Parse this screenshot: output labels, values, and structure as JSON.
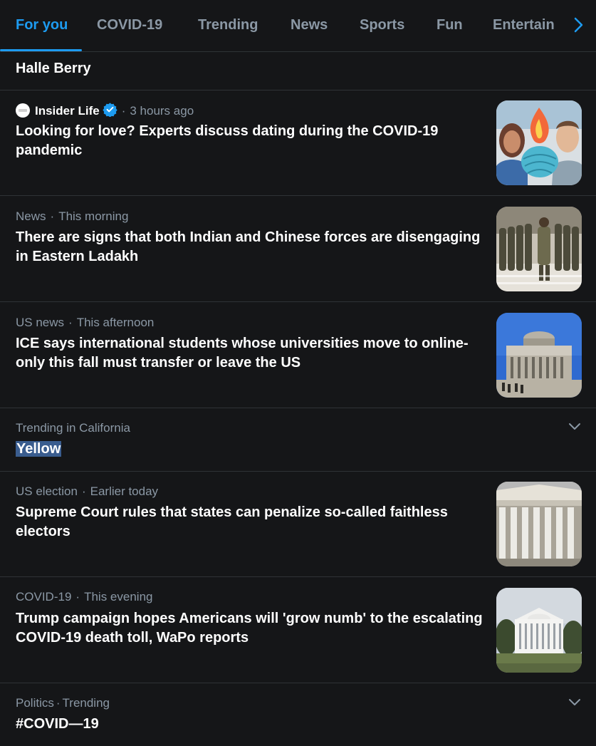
{
  "tabs": [
    {
      "label": "For you",
      "active": true
    },
    {
      "label": "COVID-19",
      "active": false
    },
    {
      "label": "Trending",
      "active": false
    },
    {
      "label": "News",
      "active": false
    },
    {
      "label": "Sports",
      "active": false
    },
    {
      "label": "Fun",
      "active": false
    },
    {
      "label": "Entertain",
      "active": false
    }
  ],
  "top_item": {
    "title": "Halle Berry"
  },
  "items": [
    {
      "source": "Insider Life",
      "verified": true,
      "time": "3 hours ago",
      "title": "Looking for love? Experts discuss dating during the COVID-19 pandemic",
      "thumb_icon": "dating-photo"
    },
    {
      "category": "News",
      "time": "This morning",
      "title": "There are signs that both Indian and Chinese forces are disengaging in Eastern Ladakh",
      "thumb_icon": "soldiers-photo"
    },
    {
      "category": "US news",
      "time": "This afternoon",
      "title": "ICE says international students whose universities move to online-only this fall must transfer or leave the US",
      "thumb_icon": "university-photo"
    },
    {
      "category": "Trending in California",
      "title": "Yellow",
      "trend": true
    },
    {
      "category": "US election",
      "time": "Earlier today",
      "title": "Supreme Court rules that states can penalize so-called faithless electors",
      "thumb_icon": "supreme-court-photo"
    },
    {
      "category": "COVID-19",
      "time": "This evening",
      "title": "Trump campaign hopes Americans will 'grow numb' to the escalating COVID-19 death toll, WaPo reports",
      "thumb_icon": "white-house-photo"
    },
    {
      "category": "Politics",
      "time": "Trending",
      "title": "#COVID—19",
      "trend": true
    }
  ],
  "colors": {
    "background": "#151618",
    "accent": "#1d9bf0",
    "muted_text": "#8b98a5",
    "divider": "#2f3336",
    "selection": "#3a5d8f"
  }
}
